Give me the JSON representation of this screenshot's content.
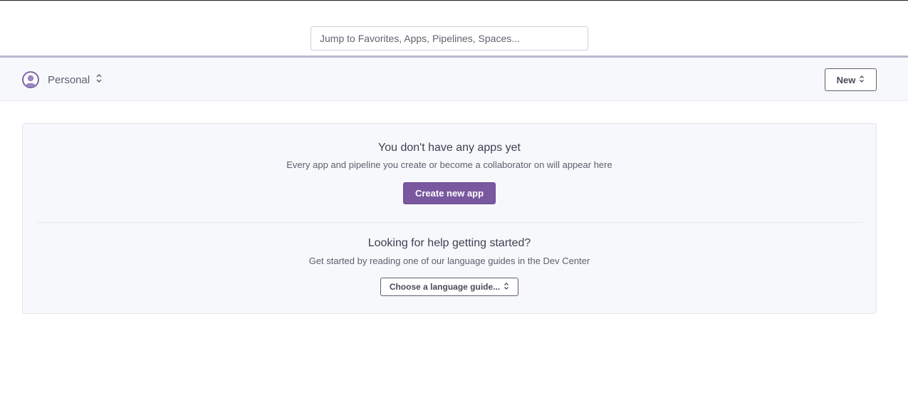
{
  "search": {
    "placeholder": "Jump to Favorites, Apps, Pipelines, Spaces..."
  },
  "team_switcher": {
    "label": "Personal",
    "avatar_icon": "user-avatar-icon",
    "chevron_icon": "chevron-up-down-icon"
  },
  "header_actions": {
    "new_label": "New",
    "new_chevron_icon": "chevron-up-down-icon"
  },
  "empty_state": {
    "title": "You don't have any apps yet",
    "subtitle": "Every app and pipeline you create or become a collaborator on will appear here",
    "create_button_label": "Create new app"
  },
  "help": {
    "title": "Looking for help getting started?",
    "subtitle": "Get started by reading one of our language guides in the Dev Center",
    "select_label": "Choose a language guide...",
    "select_chevron_icon": "chevron-up-down-icon"
  },
  "colors": {
    "brand_purple": "#79589f",
    "panel_background": "#f7f8fb",
    "header_divider": "#b7b8cf",
    "text_primary": "#3f3f52",
    "text_secondary": "#5e5e70"
  }
}
